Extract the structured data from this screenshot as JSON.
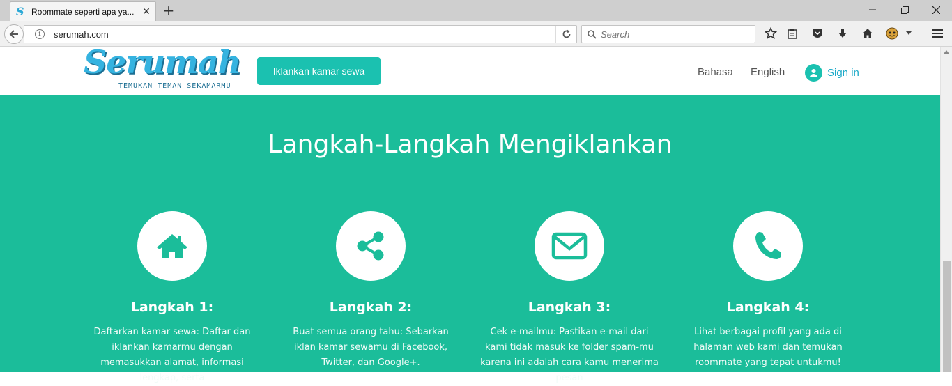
{
  "browser": {
    "tab_title": "Roommate seperti apa ya...",
    "tab_favicon": "S",
    "url": "serumah.com",
    "search_placeholder": "Search"
  },
  "header": {
    "logo_text": "Serumah",
    "logo_tagline": "TEMUKAN TEMAN SEKAMARMU",
    "cta_label": "Iklankan kamar sewa",
    "lang_bahasa": "Bahasa",
    "lang_english": "English",
    "signin_label": "Sign in"
  },
  "steps": {
    "title": "Langkah-Langkah Mengiklankan",
    "items": [
      {
        "icon": "home-icon",
        "heading": "Langkah 1:",
        "text": "Daftarkan kamar sewa: Daftar dan iklankan kamarmu dengan memasukkan alamat, informasi lengkap, serta"
      },
      {
        "icon": "share-icon",
        "heading": "Langkah 2:",
        "text": "Buat semua orang tahu: Sebarkan iklan kamar sewamu di Facebook, Twitter, dan Google+."
      },
      {
        "icon": "envelope-icon",
        "heading": "Langkah 3:",
        "text": "Cek e-mailmu: Pastikan e-mail dari kami tidak masuk ke folder spam-mu karena ini adalah cara kamu menerima pesan"
      },
      {
        "icon": "phone-icon",
        "heading": "Langkah 4:",
        "text": "Lihat berbagai profil yang ada di halaman web kami dan temukan roommate yang tepat untukmu!"
      }
    ]
  },
  "colors": {
    "accent": "#1bc1b0",
    "section_bg": "#1bbd9a",
    "logo_blue": "#35b3e0"
  }
}
